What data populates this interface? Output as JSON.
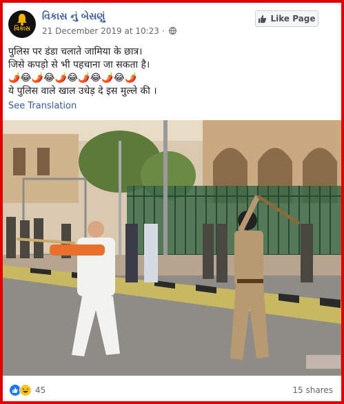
{
  "post": {
    "page_name": "વિકાસ નું બેસણું",
    "avatar_text": "વિકાસ",
    "date": "21 December 2019 at 10:23",
    "dot": "·",
    "like_page_label": "Like Page",
    "text_lines": [
      "पुलिस पर डंडा चलाते जामिया के छात्र।",
      "जिसे कपड़ो से भी पहचाना जा सकता है।",
      "🌶️😂🌶️😂🌶️😂🌶️😂🌶️😂🌶️",
      "ये पुलिस वाले खाल उधेड़ दे इस मुल्ले की ।"
    ],
    "see_translation": "See Translation",
    "reaction_count": "45",
    "shares": "15 shares"
  },
  "colors": {
    "frame": "#e00000",
    "link": "#385898",
    "meta": "#606770"
  },
  "icons": {
    "avatar": "bell-icon",
    "privacy": "globe-icon",
    "like_button": "thumbs-up-icon",
    "reactions": [
      "like-reaction-icon",
      "haha-reaction-icon"
    ]
  }
}
